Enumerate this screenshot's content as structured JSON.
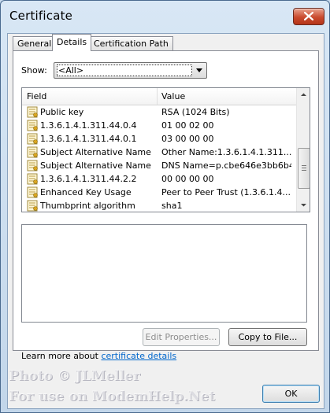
{
  "window": {
    "title": "Certificate"
  },
  "tabs": [
    {
      "label": "General"
    },
    {
      "label": "Details"
    },
    {
      "label": "Certification Path"
    }
  ],
  "show": {
    "label": "Show:",
    "selected": "<All>"
  },
  "list": {
    "headers": {
      "field": "Field",
      "value": "Value"
    },
    "rows": [
      {
        "field": "Public key",
        "value": "RSA (1024 Bits)"
      },
      {
        "field": "1.3.6.1.4.1.311.44.0.4",
        "value": "01 00 02 00"
      },
      {
        "field": "1.3.6.1.4.1.311.44.0.1",
        "value": "03 00 00 00"
      },
      {
        "field": "Subject Alternative Name",
        "value": "Other Name:1.3.6.1.4.1.311...."
      },
      {
        "field": "Subject Alternative Name",
        "value": "DNS Name=p.cbe646e3bb6b4..."
      },
      {
        "field": "1.3.6.1.4.1.311.44.2.2",
        "value": "00 00 00 00"
      },
      {
        "field": "Enhanced Key Usage",
        "value": "Peer to Peer Trust (1.3.6.1.4...."
      },
      {
        "field": "Thumbprint algorithm",
        "value": "sha1"
      }
    ]
  },
  "buttons": {
    "edit_properties": "Edit Properties...",
    "copy_to_file": "Copy to File...",
    "ok": "OK"
  },
  "learn_more": {
    "prefix": "Learn more about ",
    "link": "certificate details"
  },
  "watermark": {
    "line1": "Photo © JLMeller",
    "line2": "For use on ModemHelp.Net"
  },
  "colors": {
    "link": "#0066cc",
    "close_button": "#c94a2e"
  }
}
